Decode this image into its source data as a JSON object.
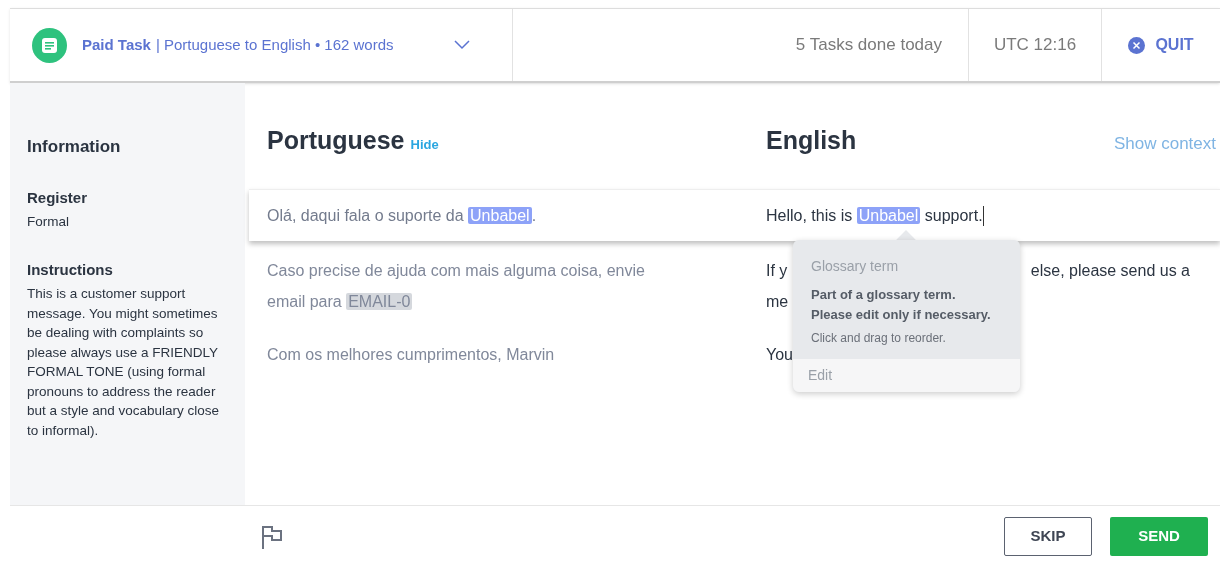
{
  "header": {
    "task_type": "Paid Task",
    "task_detail": "| Portuguese to English • 162 words",
    "tasks_done": "5 Tasks done today",
    "clock": "UTC 12:16",
    "quit": "QUIT"
  },
  "sidebar": {
    "title": "Information",
    "sections": [
      {
        "label": "Register",
        "text": "Formal"
      },
      {
        "label": "Instructions",
        "text": "This is a customer support message. You might sometimes be dealing with complaints so please always use a FRIENDLY FORMAL TONE (using formal pronouns to address the reader but a style and vocabulary close to informal)."
      }
    ]
  },
  "source": {
    "language": "Portuguese",
    "hide_link": "Hide"
  },
  "target": {
    "language": "English",
    "context_link": "Show context"
  },
  "segments": [
    {
      "selected": true,
      "source": [
        {
          "kind": "plain",
          "text": "Olá, daqui fala o suporte da "
        },
        {
          "kind": "term",
          "text": "Unbabel"
        },
        {
          "kind": "plain",
          "text": "."
        }
      ],
      "target_lines": [
        [
          {
            "kind": "plain",
            "text": "Hello, this is "
          },
          {
            "kind": "term",
            "text": "Unbabel"
          },
          {
            "kind": "plain",
            "text": " support."
          }
        ]
      ]
    },
    {
      "selected": false,
      "source": [
        {
          "kind": "plain",
          "text": "Caso precise de ajuda com mais alguma coisa, envie email para "
        },
        {
          "kind": "placeholder",
          "text": "EMAIL-0"
        }
      ],
      "target_lines": [
        [
          {
            "kind": "plain",
            "text": "If y"
          },
          {
            "kind": "gap"
          },
          {
            "kind": "plain",
            "text": "else, please send us a"
          }
        ],
        [
          {
            "kind": "plain",
            "text": "me"
          }
        ]
      ]
    },
    {
      "selected": false,
      "source": [
        {
          "kind": "plain",
          "text": "Com os melhores cumprimentos, Marvin"
        }
      ],
      "target_lines": [
        [
          {
            "kind": "plain",
            "text": "You"
          }
        ]
      ]
    }
  ],
  "tooltip": {
    "title": "Glossary term",
    "message": "Part of a glossary term.\nPlease edit only if necessary.",
    "hint": "Click and drag to reorder.",
    "action": "Edit"
  },
  "footer": {
    "skip": "SKIP",
    "send": "SEND"
  }
}
